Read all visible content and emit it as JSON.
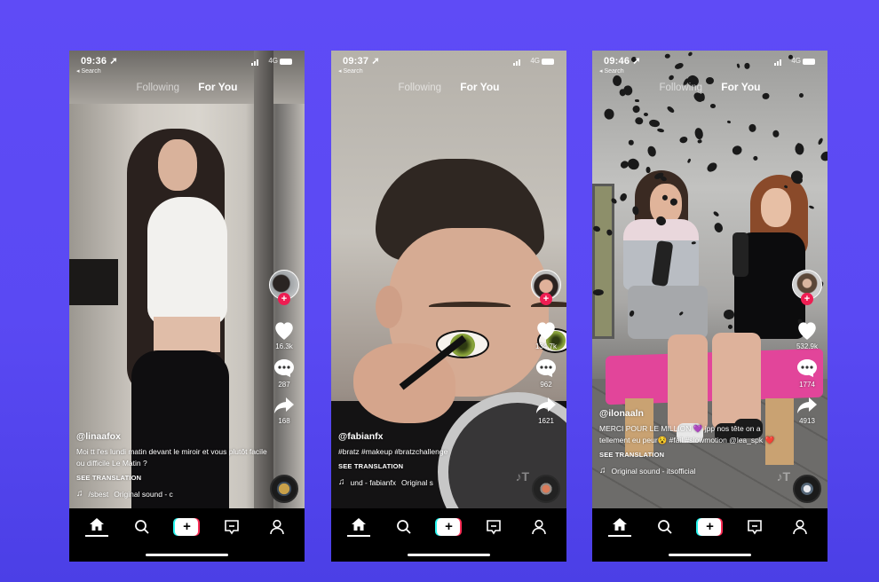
{
  "background_color": "#5b4af4",
  "phones": [
    {
      "status": {
        "time": "09:36 ➚",
        "back_label": "◂ Search",
        "network": "4G"
      },
      "tabs": {
        "following": "Following",
        "for_you": "For You"
      },
      "actions": {
        "likes": "16.3k",
        "comments": "287",
        "shares": "168"
      },
      "caption": {
        "username": "@linaafox",
        "description": "Moi tt l'es lundi matin devant le miroir et vous plutôt facile  ou difficile Le Matin  ?",
        "translate": "SEE TRANSLATION",
        "sound_prefix": "/sbest",
        "sound": "Original sound - c"
      }
    },
    {
      "status": {
        "time": "09:37 ➚",
        "back_label": "◂ Search",
        "network": "4G"
      },
      "tabs": {
        "following": "Following",
        "for_you": "For You"
      },
      "actions": {
        "likes": "134.7k",
        "comments": "962",
        "shares": "1621"
      },
      "caption": {
        "username": "@fabianfx",
        "description": "#bratz #makeup #bratzchallenge",
        "translate": "SEE TRANSLATION",
        "sound_prefix": "und - fabianfx",
        "sound": "Original s"
      }
    },
    {
      "status": {
        "time": "09:46 ➚",
        "back_label": "◂ Search",
        "network": "4G"
      },
      "tabs": {
        "following": "Following",
        "for_you": "For You"
      },
      "actions": {
        "likes": "532.9k",
        "comments": "1774",
        "shares": "4913"
      },
      "caption": {
        "username": "@ilonaaln",
        "description": "MERCI POUR LE MILLION 💜 jpp nos tête on a tellement eu peur😵 #fail #slowmotion @lea_spk ❤️",
        "translate": "SEE TRANSLATION",
        "sound_prefix": "",
        "sound": "Original sound - itsofficial"
      }
    }
  ],
  "navbar": {
    "items": [
      "home-icon",
      "search-icon",
      "create-plus-icon",
      "inbox-icon",
      "profile-icon"
    ],
    "create_label": "+",
    "active": "home"
  },
  "icons": {
    "follow_plus": "+",
    "music_note": "♫",
    "watermark": "♪T"
  },
  "colors": {
    "tiktok_red": "#fe2c55",
    "tiktok_cyan": "#25f4ee",
    "follow_red": "#ee1d52"
  }
}
